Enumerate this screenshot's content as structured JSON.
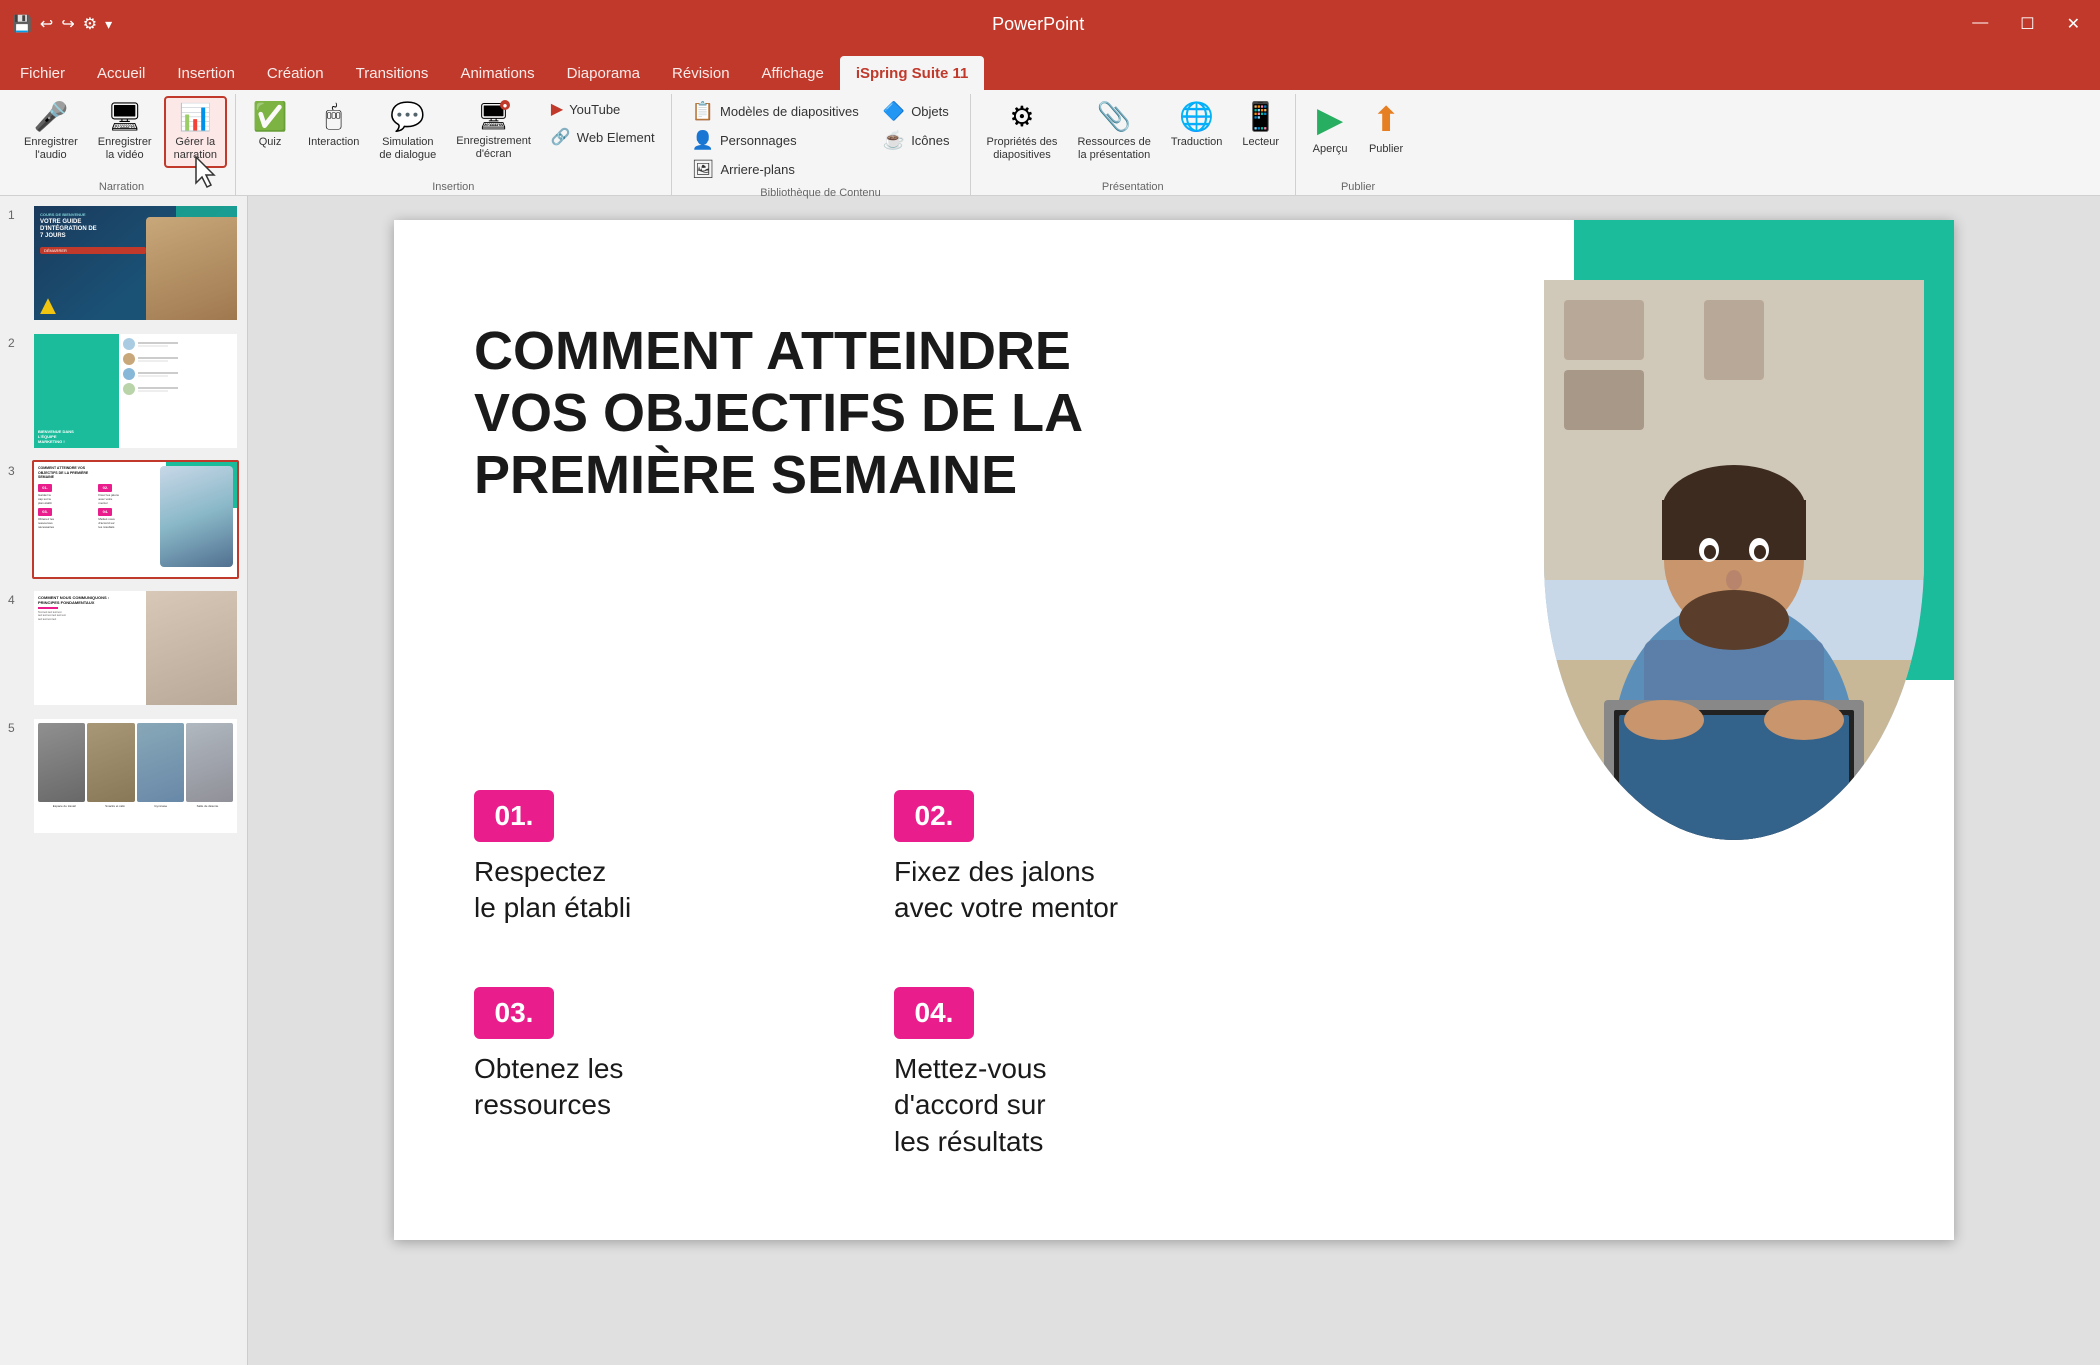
{
  "app": {
    "title": "PowerPoint",
    "minimize": "—",
    "maximize": "☐",
    "close": "✕"
  },
  "titlebar_icons": [
    "💾",
    "↩",
    "↩",
    "⚙"
  ],
  "ribbon": {
    "tabs": [
      {
        "id": "fichier",
        "label": "Fichier"
      },
      {
        "id": "accueil",
        "label": "Accueil"
      },
      {
        "id": "insertion",
        "label": "Insertion"
      },
      {
        "id": "creation",
        "label": "Création"
      },
      {
        "id": "transitions",
        "label": "Transitions"
      },
      {
        "id": "animations",
        "label": "Animations"
      },
      {
        "id": "diaporama",
        "label": "Diaporama"
      },
      {
        "id": "revision",
        "label": "Révision"
      },
      {
        "id": "affichage",
        "label": "Affichage"
      },
      {
        "id": "ispring",
        "label": "iSpring Suite 11",
        "active": true
      }
    ],
    "groups": {
      "narration": {
        "label": "Narration",
        "buttons": [
          {
            "id": "enregistrer-audio",
            "icon": "🎤",
            "label": "Enregistrer\nl'audio"
          },
          {
            "id": "enregistrer-video",
            "icon": "🖥",
            "label": "Enregistrer\nla vidéo"
          },
          {
            "id": "gerer-narration",
            "icon": "📊",
            "label": "Gérer la\nnarration",
            "active": true
          }
        ]
      },
      "insertion": {
        "label": "Insertion",
        "buttons": [
          {
            "id": "quiz",
            "icon": "✅",
            "label": "Quiz"
          },
          {
            "id": "interaction",
            "icon": "🖱",
            "label": "Interaction"
          },
          {
            "id": "simulation-dialogue",
            "icon": "💬",
            "label": "Simulation\nde dialogue"
          },
          {
            "id": "enregistrement-ecran",
            "icon": "🖥",
            "label": "Enregistrement\nd'écran"
          }
        ],
        "small_buttons": [
          {
            "id": "youtube",
            "icon": "▶",
            "label": "YouTube"
          },
          {
            "id": "web-element",
            "icon": "🔗",
            "label": "Web Element"
          }
        ]
      },
      "bibliotheque": {
        "label": "Bibliothèque de Contenu",
        "col1": [
          {
            "id": "modeles",
            "icon": "📋",
            "label": "Modèles de diapositives"
          },
          {
            "id": "personnages",
            "icon": "👤",
            "label": "Personnages"
          },
          {
            "id": "arriere-plans",
            "icon": "🖼",
            "label": "Arriere-plans"
          }
        ],
        "col2": [
          {
            "id": "objets",
            "icon": "🔷",
            "label": "Objets"
          },
          {
            "id": "icones",
            "icon": "☕",
            "label": "Icônes"
          }
        ]
      },
      "presentation": {
        "label": "Présentation",
        "buttons": [
          {
            "id": "proprietes",
            "icon": "⚙",
            "label": "Propriétés des\ndiapositives"
          },
          {
            "id": "ressources",
            "icon": "📎",
            "label": "Ressources de\nla présentation"
          },
          {
            "id": "traduction",
            "icon": "🌐",
            "label": "Traduction"
          },
          {
            "id": "lecteur",
            "icon": "📱",
            "label": "Lecteur"
          }
        ]
      },
      "publier": {
        "label": "Publier",
        "buttons": [
          {
            "id": "apercu",
            "icon": "▶",
            "label": "Aperçu"
          },
          {
            "id": "publier",
            "icon": "⬆",
            "label": "Publier"
          }
        ]
      }
    }
  },
  "slides": [
    {
      "number": "1",
      "selected": false,
      "title": "VOTRE GUIDE D'INTÉGRATION DE 7 JOURS"
    },
    {
      "number": "2",
      "selected": false,
      "title": "BIENVENUE DANS L'ÉQUIPE MARKETING !"
    },
    {
      "number": "3",
      "selected": true,
      "title": "COMMENT ATTEINDRE VOS OBJECTIFS DE LA PREMIÈRE SEMAINE"
    },
    {
      "number": "4",
      "selected": false,
      "title": "COMMENT NOUS COMMUNIQUONS : PRINCIPES FONDAMENTAUX"
    },
    {
      "number": "5",
      "selected": false,
      "title": "Espaces"
    }
  ],
  "current_slide": {
    "title": "COMMENT ATTEINDRE VOS OBJECTIFS DE LA PREMIÈRE SEMAINE",
    "items": [
      {
        "badge": "01.",
        "text": "Respectez\nle plan établi"
      },
      {
        "badge": "02.",
        "text": "Fixez des jalons\navec votre mentor"
      },
      {
        "badge": "03.",
        "text": "Obtenez les\nressources"
      },
      {
        "badge": "04.",
        "text": "Mettez-vous\nd'accord sur\nles résultats"
      }
    ]
  }
}
